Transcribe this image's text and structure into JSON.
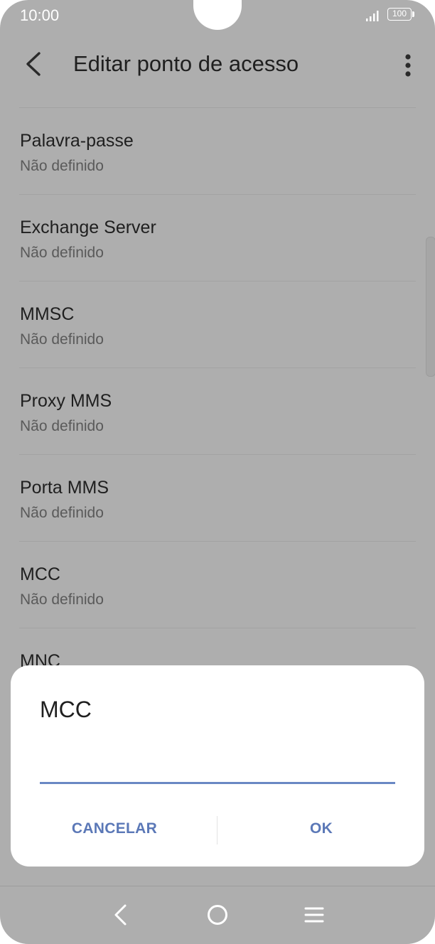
{
  "status_bar": {
    "time": "10:00",
    "battery": "100"
  },
  "header": {
    "title": "Editar ponto de acesso"
  },
  "settings": [
    {
      "title": "Palavra-passe",
      "value": "Não definido"
    },
    {
      "title": "Exchange Server",
      "value": "Não definido"
    },
    {
      "title": "MMSC",
      "value": "Não definido"
    },
    {
      "title": "Proxy MMS",
      "value": "Não definido"
    },
    {
      "title": "Porta MMS",
      "value": "Não definido"
    },
    {
      "title": "MCC",
      "value": "Não definido"
    },
    {
      "title": "MNC",
      "value": ""
    }
  ],
  "dialog": {
    "title": "MCC",
    "input_value": "",
    "cancel_label": "CANCELAR",
    "ok_label": "OK"
  },
  "colors": {
    "accent": "#5b78b7",
    "dim_background": "#aeaeae"
  }
}
